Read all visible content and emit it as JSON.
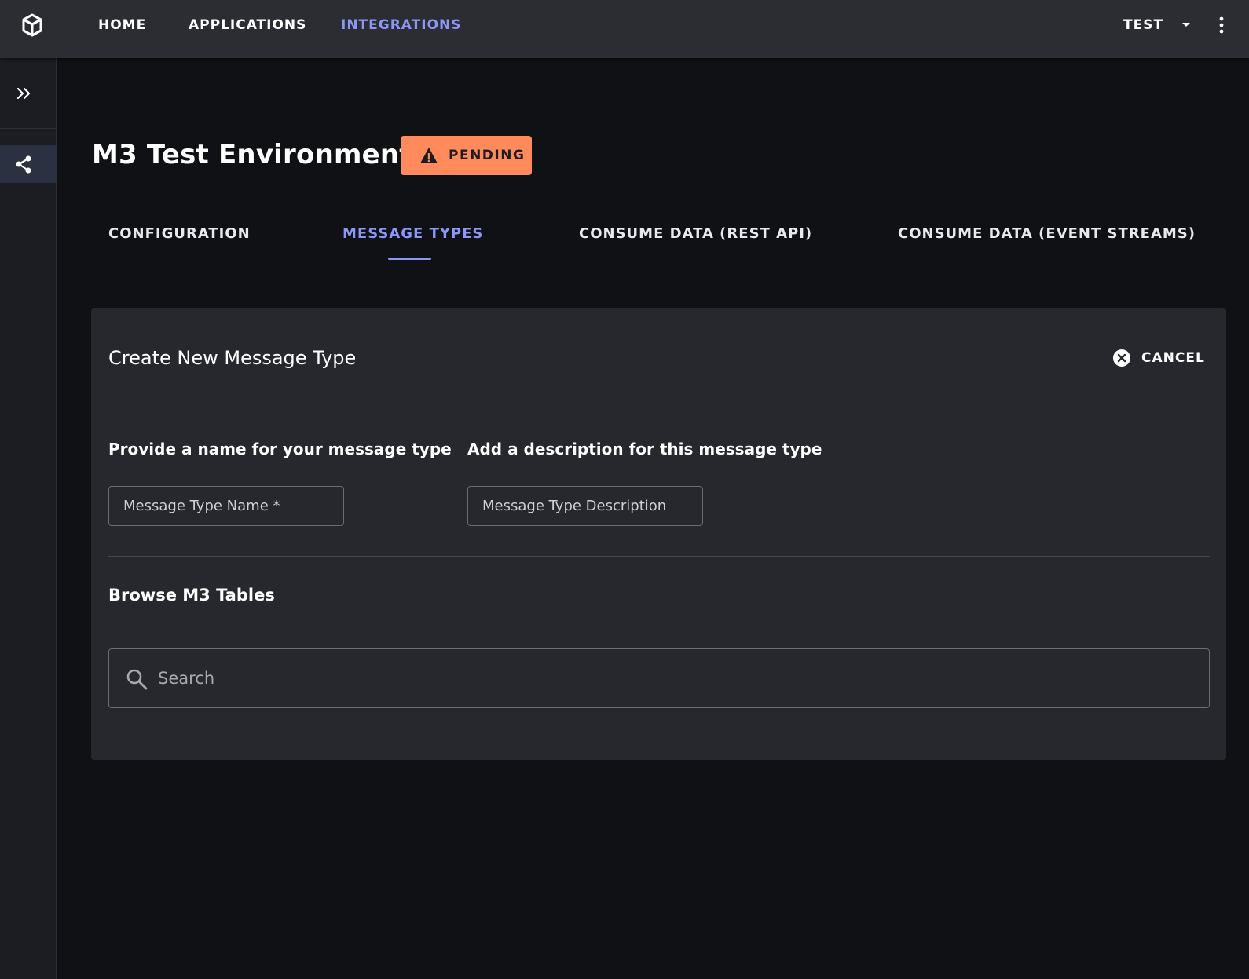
{
  "nav": {
    "logo_icon": "cube-icon",
    "items": [
      {
        "label": "HOME",
        "active": false
      },
      {
        "label": "APPLICATIONS",
        "active": false
      },
      {
        "label": "INTEGRATIONS",
        "active": true
      }
    ],
    "user_label": "TEST",
    "menu_icon": "more-vert-icon"
  },
  "sidebar": {
    "expand_icon": "double-chevron-right-icon",
    "items": [
      {
        "icon": "share-icon",
        "active": true
      }
    ]
  },
  "header": {
    "title": "M3 Test Environment",
    "status": {
      "label": "PENDING",
      "icon": "warning-icon",
      "color": "#ff8a5b"
    }
  },
  "tabs": [
    {
      "label": "CONFIGURATION",
      "active": false
    },
    {
      "label": "MESSAGE TYPES",
      "active": true
    },
    {
      "label": "CONSUME DATA (REST API)",
      "active": false
    },
    {
      "label": "CONSUME DATA (EVENT STREAMS)",
      "active": false
    }
  ],
  "form": {
    "title": "Create New Message Type",
    "cancel_label": "CANCEL",
    "name_label": "Provide a name for your message type",
    "name_placeholder": "Message Type Name *",
    "name_value": "",
    "description_label": "Add a description for this message type",
    "description_placeholder": "Message Type Description",
    "description_value": "",
    "browse_title": "Browse M3 Tables",
    "search_placeholder": "Search",
    "search_value": ""
  },
  "colors": {
    "accent": "#8c96f5",
    "pending": "#ff8a5b",
    "background": "#0f1115",
    "surface": "#26282e"
  }
}
